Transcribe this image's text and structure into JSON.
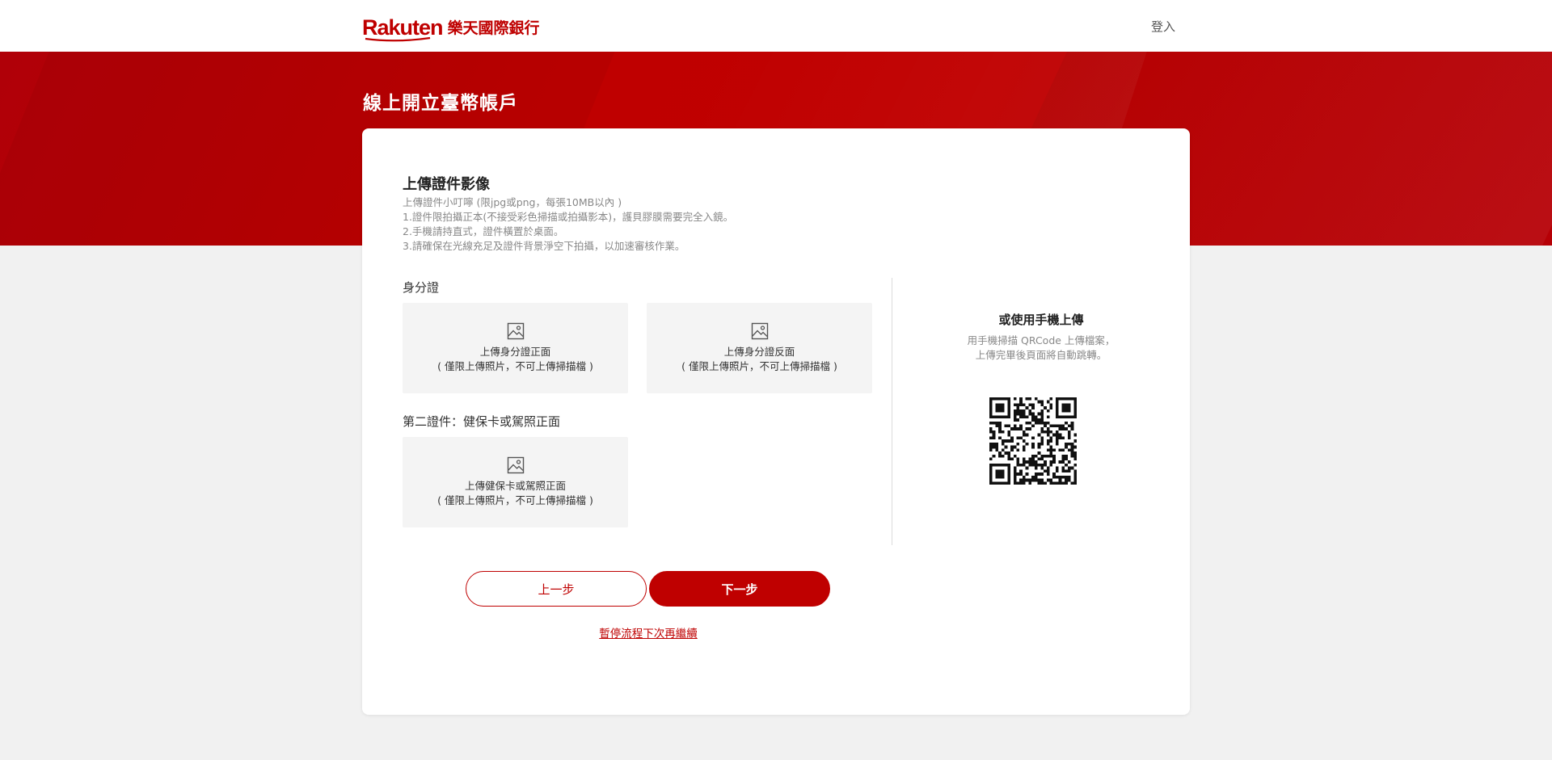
{
  "header": {
    "logo_en": "Rakuten",
    "logo_zh": "樂天國際銀行",
    "login_label": "登入"
  },
  "banner": {
    "title": "線上開立臺幣帳戶"
  },
  "upload": {
    "title": "上傳證件影像",
    "notes": [
      "上傳證件小叮嚀 (限jpg或png，每張10MB以內 )",
      "1.證件限拍攝正本(不接受彩色掃描或拍攝影本)，護貝膠膜需要完全入鏡。",
      "2.手機請持直式，證件橫置於桌面。",
      "3.請確保在光線充足及證件背景淨空下拍攝，以加速審核作業。"
    ],
    "id_card_label": "身分證",
    "id_front": {
      "line1": "上傳身分證正面",
      "line2": "( 僅限上傳照片，不可上傳掃描檔 )"
    },
    "id_back": {
      "line1": "上傳身分證反面",
      "line2": "( 僅限上傳照片，不可上傳掃描檔 )"
    },
    "second_doc_label": "第二證件：健保卡或駕照正面",
    "second_doc": {
      "line1": "上傳健保卡或駕照正面",
      "line2": "( 僅限上傳照片，不可上傳掃描檔 )"
    }
  },
  "mobile": {
    "title": "或使用手機上傳",
    "desc_line1": "用手機掃描 QRCode 上傳檔案，",
    "desc_line2": "上傳完畢後頁面將自動跳轉。"
  },
  "actions": {
    "prev_label": "上一步",
    "next_label": "下一步",
    "pause_label": "暫停流程下次再繼續"
  },
  "colors": {
    "brand": "#bf0000",
    "page_bg": "#f1f1f1",
    "upload_box_bg": "#f4f4f4"
  },
  "icons": {
    "upload_image": "image-icon",
    "qr": "qr-code"
  }
}
